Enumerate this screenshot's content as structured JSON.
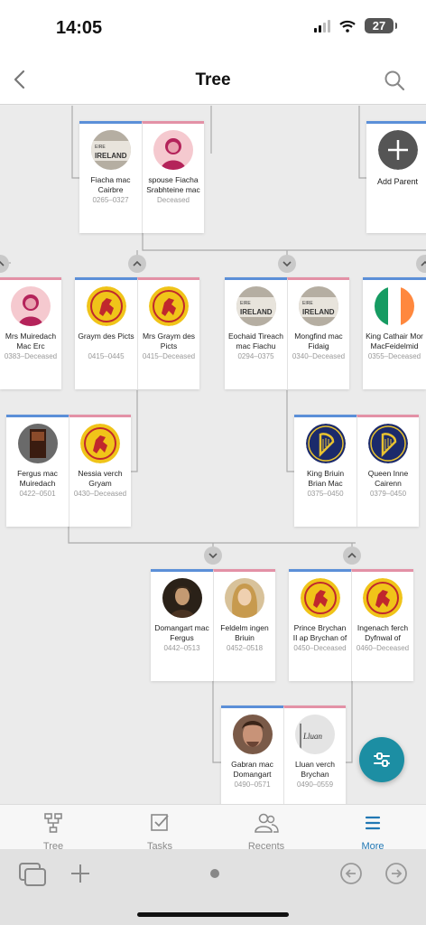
{
  "status": {
    "time": "14:05",
    "battery": "27"
  },
  "header": {
    "title": "Tree",
    "back_icon": "chevron-left-icon",
    "search_icon": "search-icon"
  },
  "people": {
    "fiacha": {
      "name": "Fiacha mac Cairbre",
      "dates": "0265–0327"
    },
    "spouse_fiacha": {
      "name": "spouse Fiacha Srabhteine mac C...",
      "dates": "Deceased"
    },
    "add_parent": {
      "label": "Add Parent"
    },
    "mrs_muiredach": {
      "name": "Mrs Muiredach Mac Erc",
      "dates": "0383–Deceased"
    },
    "graym": {
      "name": "Graym des Picts",
      "dates": "0415–0445"
    },
    "mrs_graym": {
      "name": "Mrs Graym des Picts",
      "dates": "0415–Deceased"
    },
    "eochaid": {
      "name": "Eochaid Tireach mac Fiachu",
      "dates": "0294–0375"
    },
    "mongfind": {
      "name": "Mongfind mac Fidaig",
      "dates": "0340–Deceased"
    },
    "king_cathair": {
      "name": "King Cathair Mor MacFeidelmid Th...",
      "dates": "0355–Deceased"
    },
    "fergus": {
      "name": "Fergus mac Muiredach",
      "dates": "0422–0501"
    },
    "nessia": {
      "name": "Nessia verch Gryam",
      "dates": "0430–Deceased"
    },
    "king_briuin": {
      "name": "King Briuin Brian Mac Eochaid Mui...",
      "dates": "0375–0450"
    },
    "queen_inne": {
      "name": "Queen Inne Cairenn Chasdubh",
      "dates": "0379–0450"
    },
    "domangart": {
      "name": "Domangart mac Fergus",
      "dates": "0442–0513"
    },
    "feldelm": {
      "name": "Feldelm ingen Briuin",
      "dates": "0452–0518"
    },
    "prince_brychan": {
      "name": "Prince Brychan II ap Brychan of Mana...",
      "dates": "0450–Deceased"
    },
    "ingenach": {
      "name": "Ingenach ferch Dyfnwal of Brecon",
      "dates": "0460–Deceased"
    },
    "gabran": {
      "name": "Gabran mac Domangart",
      "dates": "0490–0571"
    },
    "lluan": {
      "name": "Lluan verch Brychan",
      "dates": "0490–0559"
    }
  },
  "photo_text": {
    "eire": "EIRE",
    "ireland": "IRELAND",
    "lluan": "Lluan"
  },
  "tabs": [
    {
      "label": "Tree",
      "icon": "tree-icon"
    },
    {
      "label": "Tasks",
      "icon": "tasks-icon"
    },
    {
      "label": "Recents",
      "icon": "recents-icon"
    },
    {
      "label": "More",
      "icon": "more-icon"
    }
  ],
  "colors": {
    "male": "#5b8fd8",
    "female": "#e391a6",
    "accent": "#1c8ea3",
    "active_tab": "#2278b4"
  }
}
